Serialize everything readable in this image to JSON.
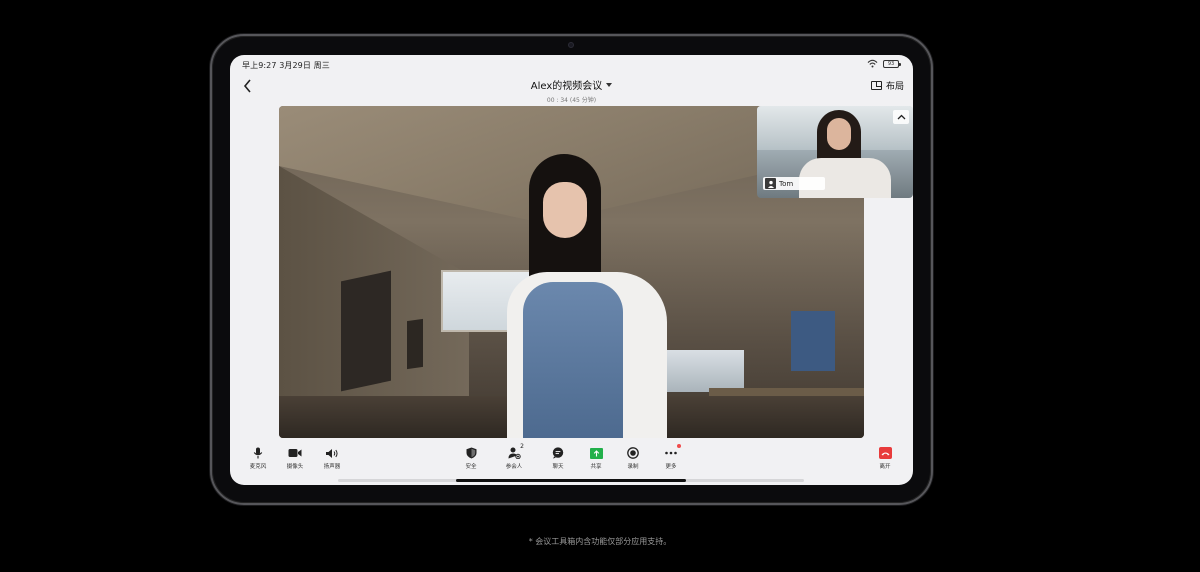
{
  "status_bar": {
    "time": "早上9:27 3月29日 周三",
    "battery": "93"
  },
  "header": {
    "title": "Alex的视频会议",
    "duration": "00 : 34 (45 分钟)",
    "layout_label": "布局"
  },
  "pip": {
    "participant_name": "Tom"
  },
  "toolbar": {
    "mic": "麦克风",
    "camera": "摄像头",
    "speaker": "扬声器",
    "security": "安全",
    "participants": "参会人",
    "participants_count": "2",
    "chat": "聊天",
    "share": "共享",
    "record": "录制",
    "more": "更多",
    "leave": "离开"
  },
  "footnote": "* 会议工具箱内含功能仅部分应用支持。",
  "colors": {
    "leave": "#e83b3b",
    "share": "#22b04a",
    "badge": "#f04b4b",
    "screen_bg": "#f1f1f3"
  }
}
